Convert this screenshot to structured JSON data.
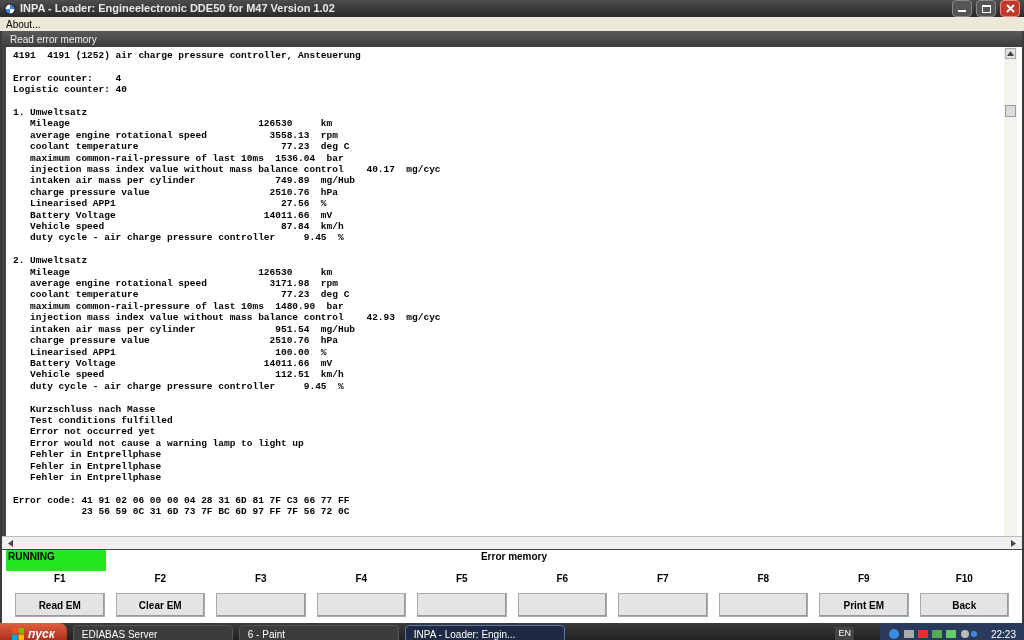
{
  "window": {
    "title": "INPA - Loader:  Engineelectronic DDE50 for M47 Version 1.02"
  },
  "menu": [
    "About..."
  ],
  "panel": {
    "title": "Read error memory"
  },
  "blocks": [
    [
      "4191  4191 (1252) air charge pressure controller, Ansteuerung"
    ],
    [
      "Error counter:    4",
      "Logistic counter: 40"
    ],
    [
      "1. Umweltsatz",
      "   Mileage                                 126530     km",
      "   average engine rotational speed           3558.13  rpm",
      "   coolant temperature                         77.23  deg C",
      "   maximum common-rail-pressure of last 10ms  1536.04  bar",
      "   injection mass index value without mass balance control    40.17  mg/cyc",
      "   intaken air mass per cylinder              749.89  mg/Hub",
      "   charge pressure value                     2510.76  hPa",
      "   Linearised APP1                             27.56  %",
      "   Battery Voltage                          14011.66  mV",
      "   Vehicle speed                               87.84  km/h",
      "   duty cycle - air charge pressure controller     9.45  %"
    ],
    [
      "2. Umweltsatz",
      "   Mileage                                 126530     km",
      "   average engine rotational speed           3171.98  rpm",
      "   coolant temperature                         77.23  deg C",
      "   maximum common-rail-pressure of last 10ms  1480.90  bar",
      "   injection mass index value without mass balance control    42.93  mg/cyc",
      "   intaken air mass per cylinder              951.54  mg/Hub",
      "   charge pressure value                     2510.76  hPa",
      "   Linearised APP1                            100.00  %",
      "   Battery Voltage                          14011.66  mV",
      "   Vehicle speed                              112.51  km/h",
      "   duty cycle - air charge pressure controller     9.45  %"
    ],
    [
      "   Kurzschluss nach Masse",
      "   Test conditions fulfilled",
      "   Error not occurred yet",
      "   Error would not cause a warning lamp to light up",
      "   Fehler in Entprellphase",
      "   Fehler in Entprellphase",
      "   Fehler in Entprellphase"
    ],
    [
      "Error code: 41 91 02 06 00 00 04 28 31 6D 81 7F C3 66 77 FF",
      "            23 56 59 0C 31 6D 73 7F BC 6D 97 FF 7F 56 72 0C"
    ]
  ],
  "status": {
    "state": "RUNNING",
    "title": "Error memory"
  },
  "fkeys": [
    {
      "key": "F1",
      "label": "Read EM"
    },
    {
      "key": "F2",
      "label": "Clear EM"
    },
    {
      "key": "F3"
    },
    {
      "key": "F4"
    },
    {
      "key": "F5"
    },
    {
      "key": "F6"
    },
    {
      "key": "F7"
    },
    {
      "key": "F8"
    },
    {
      "key": "F9",
      "label": "Print EM"
    },
    {
      "key": "F10",
      "label": "Back"
    }
  ],
  "taskbar": {
    "start": "пуск",
    "tasks": [
      {
        "label": "EDIABAS Server",
        "selected": false
      },
      {
        "label": "6 - Paint",
        "selected": false
      },
      {
        "label": "INPA - Loader:  Engin...",
        "selected": true
      }
    ],
    "language": "EN",
    "clock": "22:23"
  }
}
